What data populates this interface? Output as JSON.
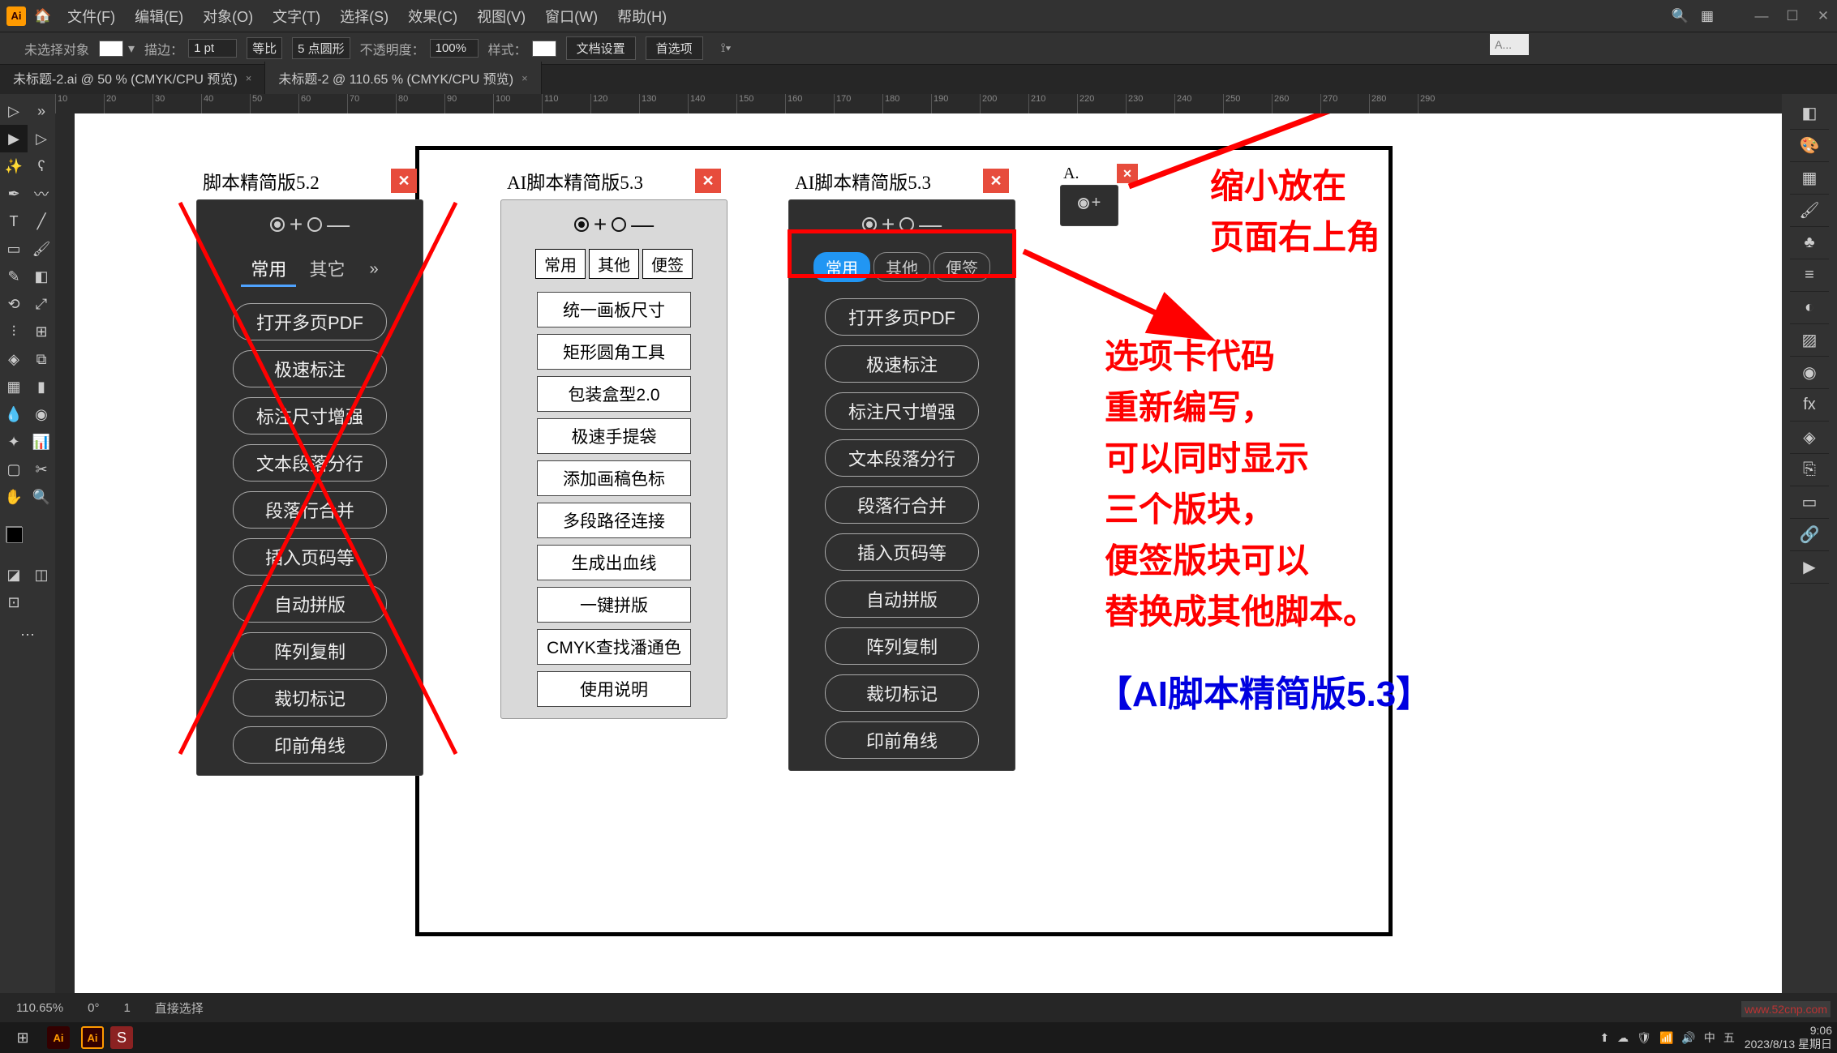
{
  "app": {
    "logo": "Ai",
    "menus": [
      "文件(F)",
      "编辑(E)",
      "对象(O)",
      "文字(T)",
      "选择(S)",
      "效果(C)",
      "视图(V)",
      "窗口(W)",
      "帮助(H)"
    ],
    "topright_minibox": "A..."
  },
  "options": {
    "label1": "未选择对象",
    "stroke_label": "描边：",
    "stroke_value": "1 pt",
    "uniform": "等比",
    "brush": "5 点圆形",
    "opacity_label": "不透明度：",
    "opacity_value": "100%",
    "style_label": "样式：",
    "btn1": "文档设置",
    "btn2": "首选项"
  },
  "tabs": [
    {
      "label": "未标题-2.ai @ 50 % (CMYK/CPU 预览)",
      "active": false
    },
    {
      "label": "未标题-2 @ 110.65 % (CMYK/CPU 预览)",
      "active": true
    }
  ],
  "statusbar": {
    "zoom": "110.65%",
    "angle": "0°",
    "artboard": "1",
    "tool": "直接选择"
  },
  "taskbar": {
    "time": "9:06",
    "date": "2023/8/13 星期日"
  },
  "panel1": {
    "title": "脚本精简版5.2",
    "tabs": [
      "常用",
      "其它"
    ],
    "buttons": [
      "打开多页PDF",
      "极速标注",
      "标注尺寸增强",
      "文本段落分行",
      "段落行合并",
      "插入页码等",
      "自动拼版",
      "阵列复制",
      "裁切标记",
      "印前角线"
    ]
  },
  "panel2": {
    "title": "AI脚本精简版5.3",
    "tabs": [
      "常用",
      "其他",
      "便签"
    ],
    "buttons": [
      "统一画板尺寸",
      "矩形圆角工具",
      "包装盒型2.0",
      "极速手提袋",
      "添加画稿色标",
      "多段路径连接",
      "生成出血线",
      "一键拼版",
      "CMYK查找潘通色",
      "使用说明"
    ]
  },
  "panel3": {
    "title": "AI脚本精简版5.3",
    "tabs": [
      "常用",
      "其他",
      "便签"
    ],
    "buttons": [
      "打开多页PDF",
      "极速标注",
      "标注尺寸增强",
      "文本段落分行",
      "段落行合并",
      "插入页码等",
      "自动拼版",
      "阵列复制",
      "裁切标记",
      "印前角线"
    ]
  },
  "panel4": {
    "title": "A."
  },
  "annotations": {
    "top": "缩小放在\n页面右上角",
    "middle": "选项卡代码\n重新编写，\n可以同时显示\n三个版块，\n便签版块可以\n替换成其他脚本。",
    "bottom": "【AI脚本精简版5.3】"
  },
  "ruler": [
    "10",
    "20",
    "30",
    "40",
    "50",
    "60",
    "70",
    "80",
    "90",
    "100",
    "110",
    "120",
    "130",
    "140",
    "150",
    "160",
    "170",
    "180",
    "190",
    "200",
    "210",
    "220",
    "230",
    "240",
    "250",
    "260",
    "270",
    "280",
    "290"
  ],
  "watermark": "www.52cnp.com"
}
